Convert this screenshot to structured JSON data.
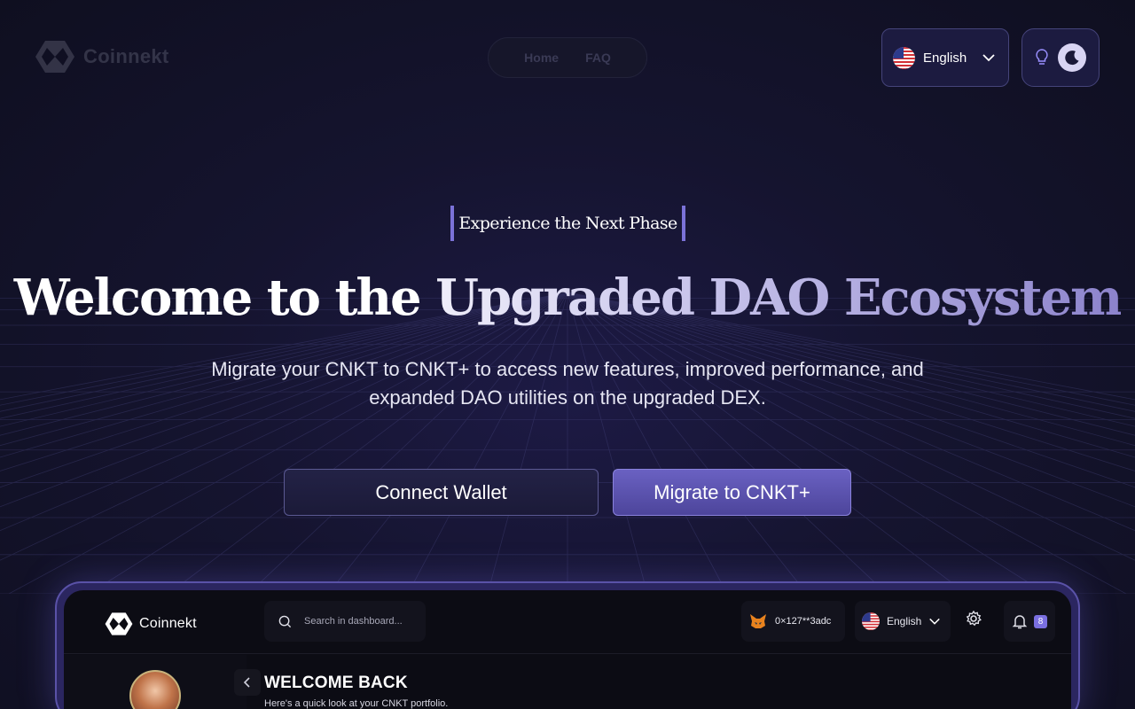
{
  "header": {
    "brand": "Coinnekt",
    "nav": [
      {
        "label": "Home"
      },
      {
        "label": "FAQ"
      }
    ],
    "language": {
      "selected": "English"
    }
  },
  "hero": {
    "eyebrow": "Experience the Next Phase",
    "title_part1": "Welcome to the ",
    "title_part2": "Upgraded DAO Ecosystem",
    "subtitle": "Migrate your CNKT to CNKT+ to access new features, improved performance, and expanded DAO utilities on the upgraded DEX.",
    "connect_label": "Connect Wallet",
    "migrate_label": "Migrate to CNKT+"
  },
  "preview": {
    "brand": "Coinnekt",
    "search_placeholder": "Search in dashboard...",
    "wallet_address": "0×127**3adc",
    "language": "English",
    "notification_count": "8",
    "welcome_title": "WELCOME BACK",
    "welcome_subtitle": "Here's a quick look at your CNKT portfolio."
  },
  "colors": {
    "accent": "#7b72d8",
    "migrate_button": "#5a52b0",
    "background": "#15142f"
  }
}
